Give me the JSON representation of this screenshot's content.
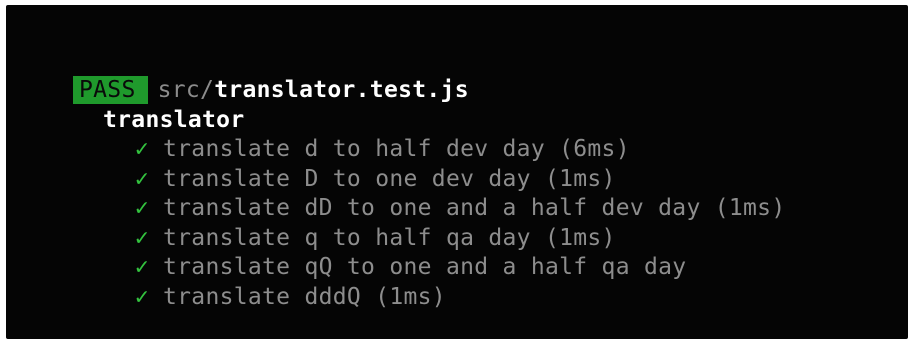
{
  "header": {
    "status": "PASS",
    "file_dir": "src/",
    "file_name": "translator.test.js"
  },
  "suite": {
    "name": "translator"
  },
  "tests": [
    {
      "icon": "check-icon",
      "mark": "✓",
      "label": "translate d to half dev day (6ms)"
    },
    {
      "icon": "check-icon",
      "mark": "✓",
      "label": "translate D to one dev day (1ms)"
    },
    {
      "icon": "check-icon",
      "mark": "✓",
      "label": "translate dD to one and a half dev day (1ms)"
    },
    {
      "icon": "check-icon",
      "mark": "✓",
      "label": "translate q to half qa day (1ms)"
    },
    {
      "icon": "check-icon",
      "mark": "✓",
      "label": "translate qQ to one and a half qa day"
    },
    {
      "icon": "check-icon",
      "mark": "✓",
      "label": "translate dddQ (1ms)"
    }
  ],
  "colors": {
    "background": "#050505",
    "pass_badge": "#1f9a2c",
    "check": "#33c23f",
    "muted_text": "#8d8d8d",
    "bright_text": "#ffffff"
  }
}
